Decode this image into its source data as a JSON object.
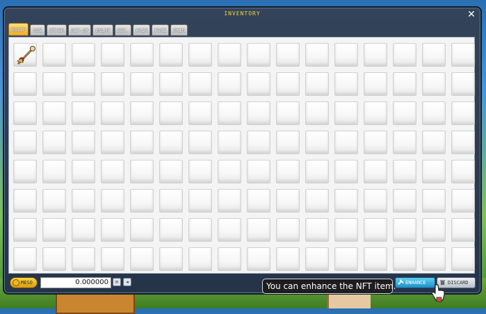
{
  "window": {
    "title": "INVENTORY",
    "close_label": "✕"
  },
  "tabs": [
    {
      "label": "EQUIP",
      "active": true
    },
    {
      "label": "USE",
      "active": false
    },
    {
      "label": "OTHER",
      "active": false
    },
    {
      "label": "SET-UP",
      "active": false
    },
    {
      "label": "UNLMY",
      "active": false
    },
    {
      "label": "DEC.",
      "active": false
    },
    {
      "label": "HAIR",
      "active": false
    },
    {
      "label": "FACE",
      "active": false
    },
    {
      "label": "SKIN",
      "active": false
    }
  ],
  "grid": {
    "columns": 16,
    "rows": 8,
    "items": [
      {
        "slot": 0,
        "icon": "staff-weapon-icon"
      }
    ]
  },
  "meso": {
    "label": "MESO",
    "value": "0.000000"
  },
  "tooltip": {
    "text": "You can enhance the NFT item."
  },
  "buttons": {
    "enhance_label": "ENHANCE",
    "discard_label": "DISCARD"
  },
  "colors": {
    "title": "#f4d23a",
    "active_tab": "#f0a820",
    "enhance": "#1f8fc6"
  }
}
